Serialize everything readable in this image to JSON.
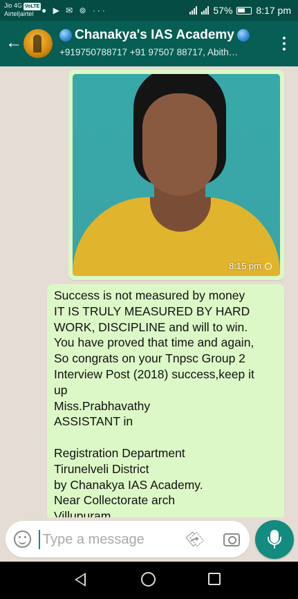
{
  "statusbar": {
    "carrier1": "Jio 4G",
    "carrier1_badge": "VoLTE",
    "carrier2": "Airtel|airtel",
    "icons": "● ▶ ✉ ⊚ ···",
    "battery_percent": "57%",
    "time": "8:17 pm"
  },
  "header": {
    "title": "Chanakya's IAS Academy",
    "subtitle": "+919750788717 +91 97507 88717, Abith…",
    "back_icon": "←"
  },
  "messages": [
    {
      "type": "image",
      "time": "8:15 pm",
      "status_icon": "clock-icon"
    },
    {
      "type": "text",
      "lines": [
        "Success is not measured by money",
        "IT IS TRULY MEASURED BY HARD",
        "WORK, DISCIPLINE and will to win.",
        "You have proved that time and again,",
        "So congrats on your Tnpsc Group 2",
        "Interview Post (2018) success,keep it",
        "up",
        "Miss.Prabhavathy",
        "ASSISTANT in",
        "",
        "Registration Department",
        "Tirunelveli District",
        "by Chanakya IAS Academy.",
        "Near Collectorate arch",
        "Villupuram"
      ]
    }
  ],
  "composer": {
    "placeholder": "Type a message",
    "attach_icon": "⎘"
  },
  "colors": {
    "header": "#075e54",
    "statusbar": "#054d44",
    "bubble_out": "#dcf8c6",
    "accent": "#128c7e"
  }
}
